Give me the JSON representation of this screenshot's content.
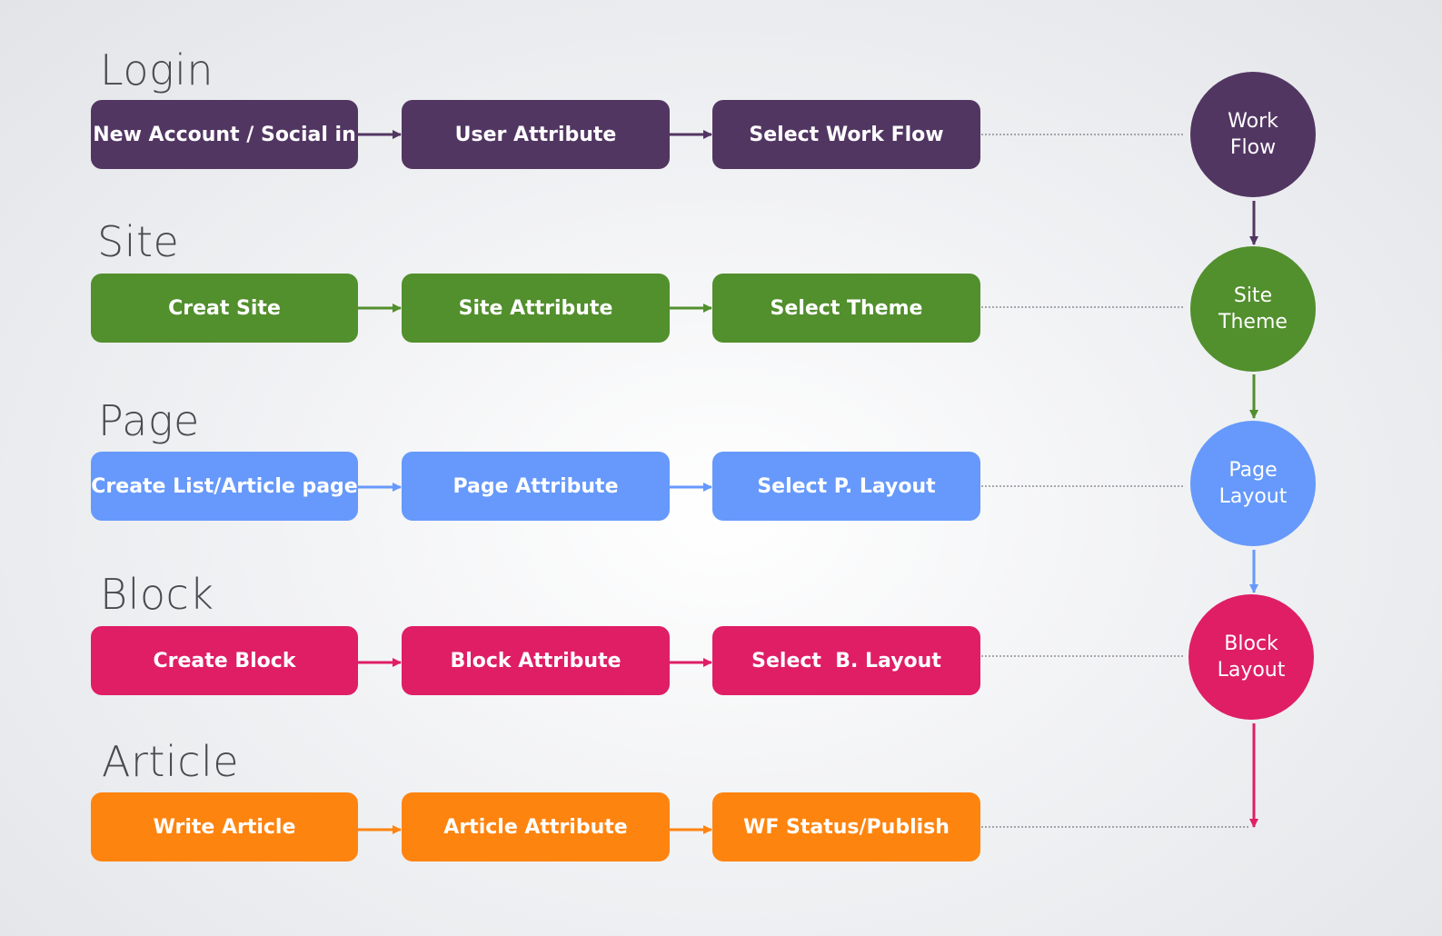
{
  "sections": [
    {
      "title": "Login",
      "steps": [
        "New Account / Social in",
        "User Attribute",
        "Select Work Flow"
      ],
      "circle": [
        "Work",
        "Flow"
      ],
      "color": "#523662"
    },
    {
      "title": "Site",
      "steps": [
        "Creat Site",
        "Site Attribute",
        "Select Theme"
      ],
      "circle": [
        "Site",
        "Theme"
      ],
      "color": "#528f2d"
    },
    {
      "title": "Page",
      "steps": [
        "Create List/Article page",
        "Page Attribute",
        "Select P. Layout"
      ],
      "circle": [
        "Page",
        "Layout"
      ],
      "color": "#6699fb"
    },
    {
      "title": "Block",
      "steps": [
        "Create Block",
        "Block Attribute",
        "Select  B. Layout"
      ],
      "circle": [
        "Block",
        "Layout"
      ],
      "color": "#df1e66"
    },
    {
      "title": "Article",
      "steps": [
        "Write Article",
        "Article Attribute",
        "WF Status/Publish"
      ],
      "color": "#fe8410"
    }
  ]
}
